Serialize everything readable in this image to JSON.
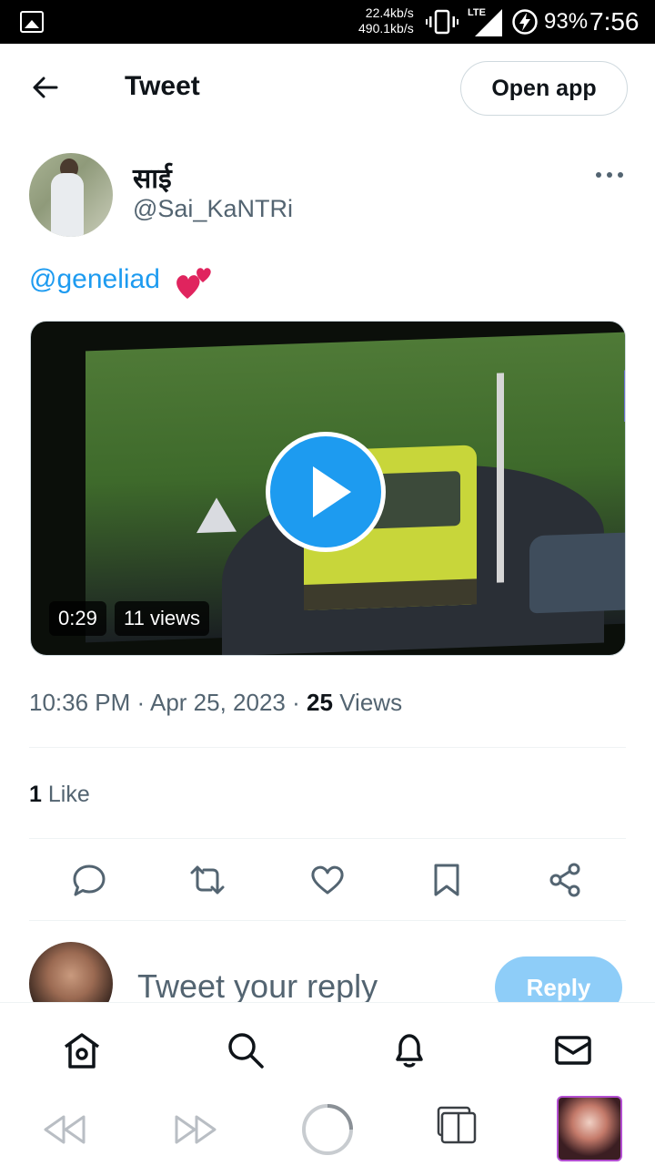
{
  "status_bar": {
    "speed_up": "22.4kb/s",
    "speed_down": "490.1kb/s",
    "network": "LTE",
    "battery": "93%",
    "time": "7:56"
  },
  "header": {
    "title": "Tweet",
    "open_app_label": "Open app"
  },
  "author": {
    "name": "साई",
    "handle": "@Sai_KaNTRi"
  },
  "tweet": {
    "mention": "@geneliad",
    "emoji": "💕"
  },
  "video": {
    "duration": "0:29",
    "views": "11 views"
  },
  "meta": {
    "time": "10:36 PM",
    "separator": "·",
    "date": "Apr 25, 2023",
    "views_count": "25",
    "views_label": "Views"
  },
  "likes": {
    "count": "1",
    "label": "Like"
  },
  "actions": [
    "reply-icon",
    "retweet-icon",
    "like-icon",
    "bookmark-icon",
    "share-icon"
  ],
  "reply": {
    "placeholder": "Tweet your reply",
    "button_label": "Reply"
  },
  "bottom_nav": [
    "home-icon",
    "search-icon",
    "notifications-icon",
    "messages-icon"
  ],
  "colors": {
    "accent": "#1d9bf0",
    "text_secondary": "#536471",
    "reply_button_disabled": "#8ecdf8"
  }
}
